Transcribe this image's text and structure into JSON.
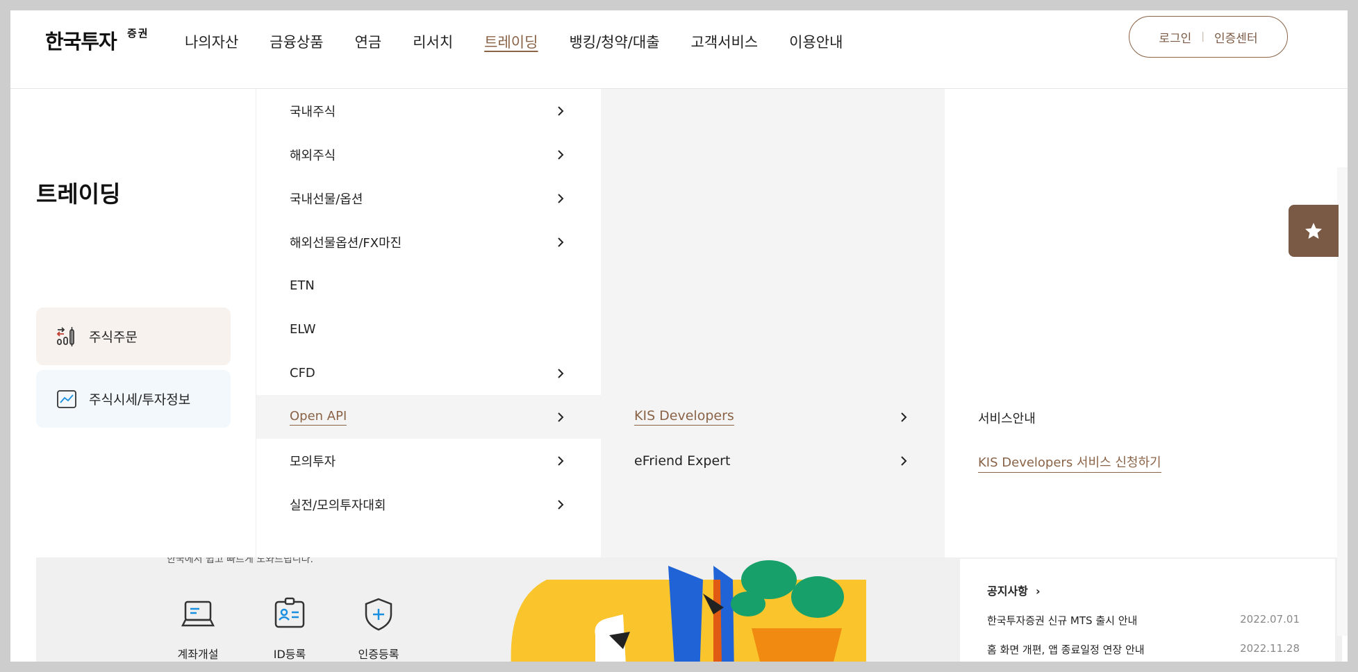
{
  "header": {
    "logo": "한국투자",
    "logo_sub": "증권",
    "nav": [
      "나의자산",
      "금융상품",
      "연금",
      "리서치",
      "트레이딩",
      "뱅킹/청약/대출",
      "고객서비스",
      "이용안내"
    ],
    "active_nav": "트레이딩",
    "login": "로그인",
    "auth_center": "인증센터"
  },
  "mega": {
    "title": "트레이딩",
    "side_buttons": [
      {
        "label": "주식주문",
        "icon": "stock-order-icon"
      },
      {
        "label": "주식시세/투자정보",
        "icon": "chart-trend-icon"
      }
    ],
    "col1": [
      {
        "label": "국내주식",
        "has_sub": true
      },
      {
        "label": "해외주식",
        "has_sub": true
      },
      {
        "label": "국내선물/옵션",
        "has_sub": true
      },
      {
        "label": "해외선물옵션/FX마진",
        "has_sub": true
      },
      {
        "label": "ETN",
        "has_sub": false
      },
      {
        "label": "ELW",
        "has_sub": false
      },
      {
        "label": "CFD",
        "has_sub": true
      },
      {
        "label": "Open API",
        "has_sub": true,
        "active": true
      },
      {
        "label": "모의투자",
        "has_sub": true
      },
      {
        "label": "실전/모의투자대회",
        "has_sub": true
      }
    ],
    "col2": [
      {
        "label": "KIS Developers",
        "active": true
      },
      {
        "label": "eFriend Expert",
        "active": false
      }
    ],
    "col3": [
      {
        "label": "서비스안내",
        "active": false
      },
      {
        "label": "KIS Developers 서비스 신청하기",
        "active": true
      }
    ],
    "favorite_icon": "star-icon"
  },
  "background": {
    "sub_text": "한국에서 쉽고 빠르게 도와드립니다.",
    "quick_links": [
      {
        "label": "계좌개설",
        "icon": "laptop-icon"
      },
      {
        "label": "ID등록",
        "icon": "id-card-icon"
      },
      {
        "label": "인증등록",
        "icon": "shield-plus-icon"
      }
    ],
    "notice_title": "공지사항",
    "notices": [
      {
        "title": "한국투자증권 신규 MTS 출시 안내",
        "date": "2022.07.01"
      },
      {
        "title": "홈 화면 개편, 앱 종료일정 연장 안내",
        "date": "2022.11.28"
      }
    ]
  },
  "colors": {
    "accent": "#8a6347",
    "fav_bg": "#7a5a44",
    "menu_gray": "#f4f4f4"
  }
}
